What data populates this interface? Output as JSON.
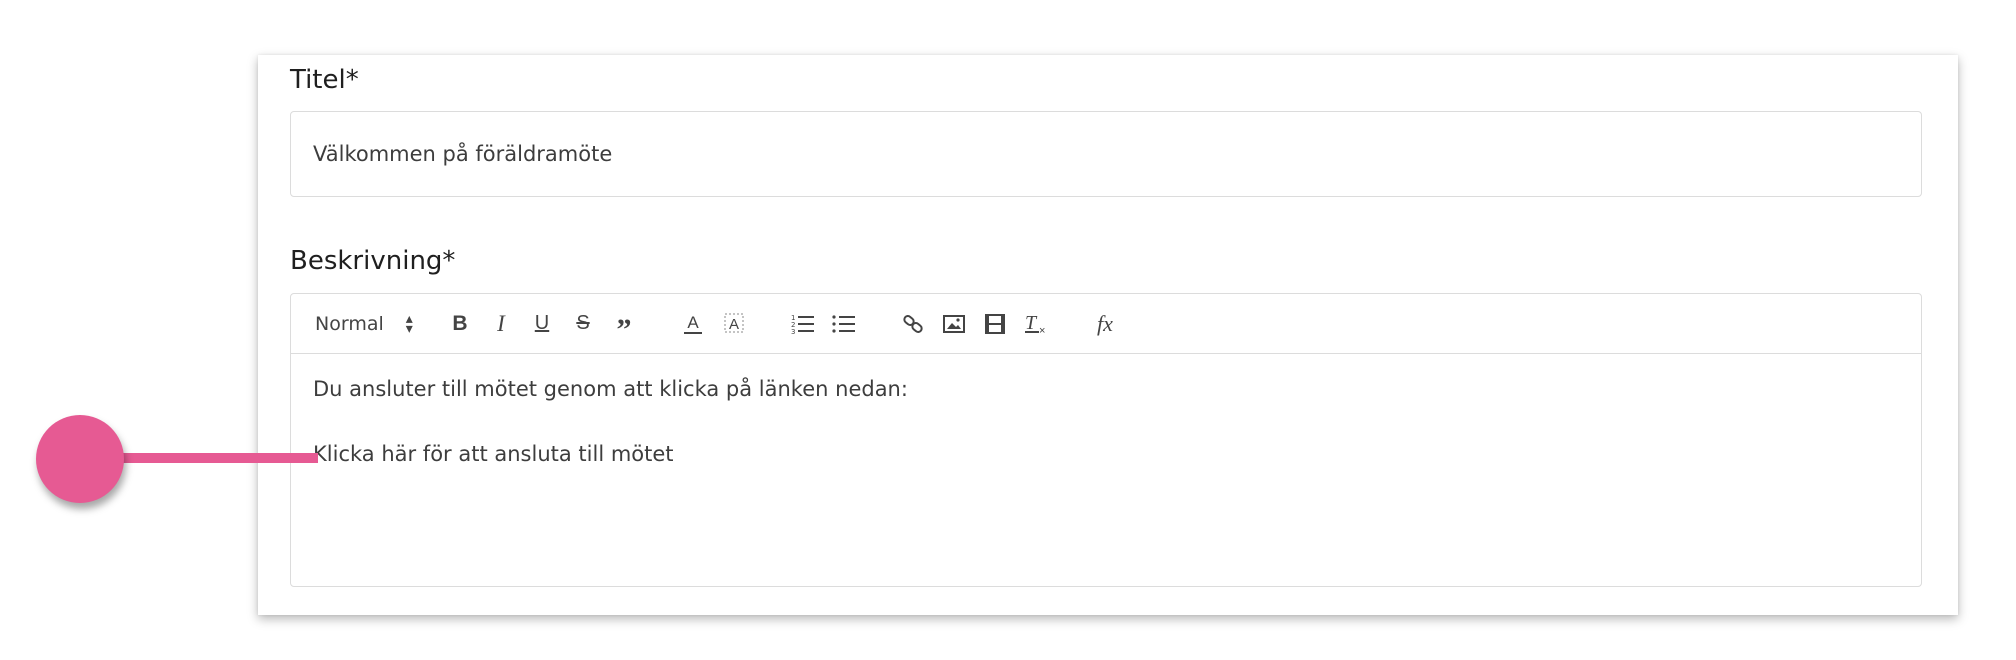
{
  "form": {
    "title_label": "Titel*",
    "title_value": "Välkommen på föräldramöte",
    "description_label": "Beskrivning*"
  },
  "toolbar": {
    "format_select": "Normal",
    "bold": "B",
    "italic": "I",
    "underline": "U",
    "strike": "S",
    "quote": "”",
    "color": "A",
    "formula": "fx",
    "icons": [
      "bold-icon",
      "italic-icon",
      "underline-icon",
      "strike-icon",
      "quote-icon",
      "text-color-icon",
      "background-color-icon",
      "ordered-list-icon",
      "bullet-list-icon",
      "link-icon",
      "image-icon",
      "video-icon",
      "clear-format-icon",
      "formula-icon"
    ]
  },
  "editor": {
    "paragraphs": [
      "Du ansluter till mötet genom att klicka på länken nedan:",
      "Klicka här för att ansluta till mötet"
    ]
  },
  "colors": {
    "callout": "#e65a93",
    "border": "#dcdcdc"
  }
}
